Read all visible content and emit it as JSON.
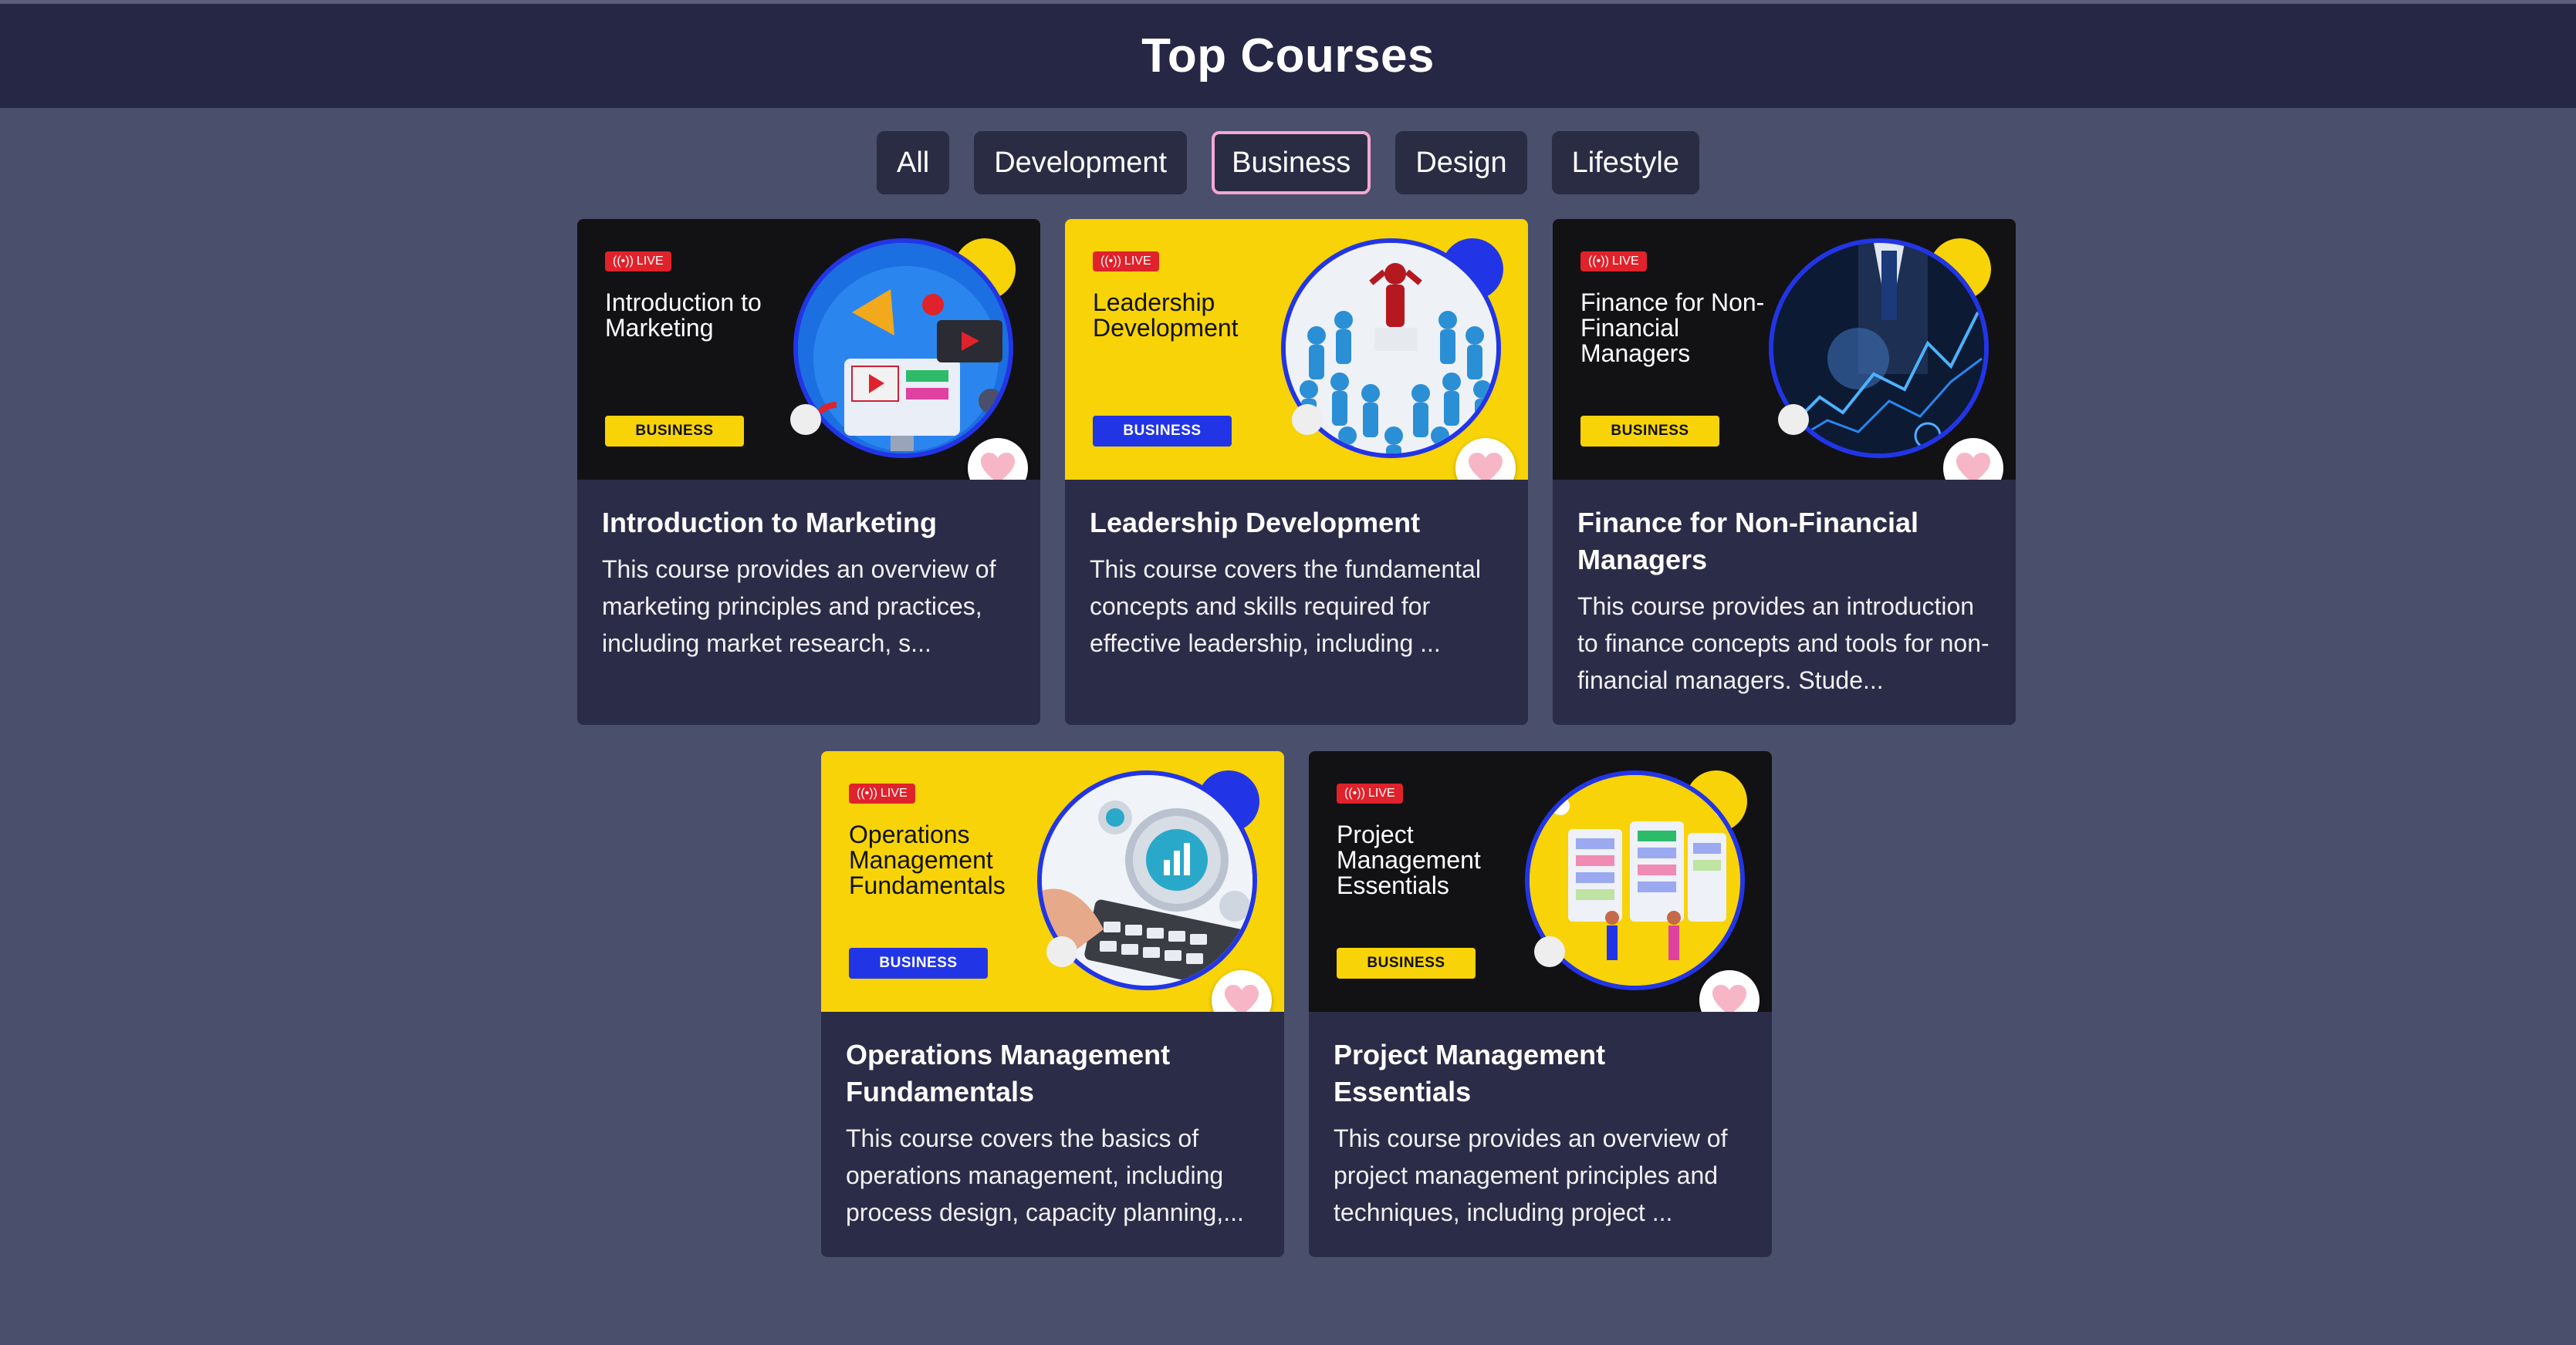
{
  "page": {
    "title": "Top Courses"
  },
  "filters": [
    {
      "label": "All",
      "active": false
    },
    {
      "label": "Development",
      "active": false
    },
    {
      "label": "Business",
      "active": true
    },
    {
      "label": "Design",
      "active": false
    },
    {
      "label": "Lifestyle",
      "active": false
    }
  ],
  "courses": [
    {
      "thumb_theme": "dark",
      "live_label": "LIVE",
      "thumb_title": "Introduction to Marketing",
      "category": "BUSINESS",
      "title": "Introduction to Marketing",
      "description": "This course provides an overview of marketing principles and practices, including market research, s...",
      "image_icon": "marketing-illustration-icon"
    },
    {
      "thumb_theme": "yellow",
      "live_label": "LIVE",
      "thumb_title": "Leadership Development",
      "category": "BUSINESS",
      "title": "Leadership Development",
      "description": "This course covers the fundamental concepts and skills required for effective leadership, including ...",
      "image_icon": "leadership-crowd-icon"
    },
    {
      "thumb_theme": "dark",
      "live_label": "LIVE",
      "thumb_title": "Finance for Non-Financial Managers",
      "category": "BUSINESS",
      "title": "Finance for Non-Financial Managers",
      "description": "This course provides an introduction to finance concepts and tools for non-financial managers. Stude...",
      "image_icon": "finance-chart-icon"
    },
    {
      "thumb_theme": "yellow",
      "live_label": "LIVE",
      "thumb_title": "Operations Management Fundamentals",
      "category": "BUSINESS",
      "title": "Operations Management Fundamentals",
      "description": "This course covers the basics of operations management, including process design, capacity planning,...",
      "image_icon": "operations-gears-icon"
    },
    {
      "thumb_theme": "dark",
      "live_label": "LIVE",
      "thumb_title": "Project Management Essentials",
      "category": "BUSINESS",
      "title": "Project Management Essentials",
      "description": "This course provides an overview of project management principles and techniques, including project ...",
      "image_icon": "project-board-icon"
    }
  ],
  "colors": {
    "background": "#4a4f6b",
    "header": "#252745",
    "card": "#2b2c47",
    "accent_yellow": "#f7d308",
    "accent_blue": "#2235e6",
    "live_red": "#e0222b",
    "active_filter_border": "#f3a8d2",
    "heart": "#f7b6c6"
  }
}
